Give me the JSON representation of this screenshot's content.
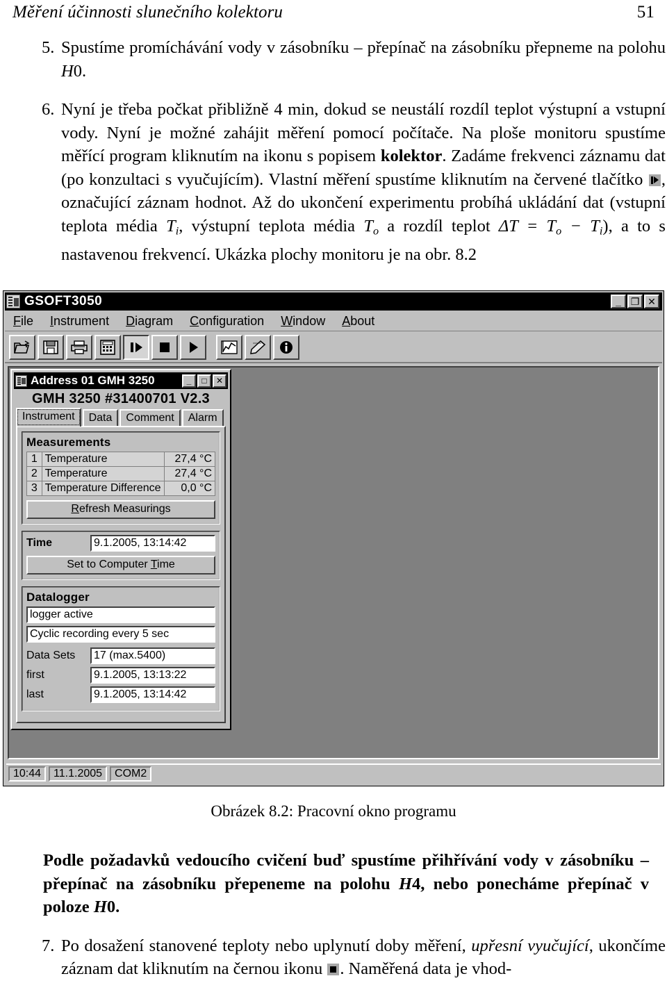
{
  "running_head": {
    "title": "Měření účinnosti slunečního kolektoru",
    "page_number": "51"
  },
  "items": [
    {
      "number": "5.",
      "text_parts": [
        "Spustíme promíchávání vody v zásobníku – přepínač na zásobníku přepneme na polohu ",
        "H",
        "0."
      ]
    },
    {
      "number": "6.",
      "lead": "Nyní je třeba počkat přibližně 4 min, dokud se neustálí rozdíl teplot výstupní a vstupní vody. Nyní je možné zahájit měření pomocí počítače. Na ploše monitoru spustíme měřící program kliknutím na ikonu s popisem ",
      "keyword": "kolektor",
      "mid": ". Zadáme frekvenci záznamu dat (po konzultaci s vyučujícím). Vlastní měření spustíme kliknutím na červené tlačítko ",
      "after_icon": ", označující záznam hodnot. Až do ukončení experimentu probíhá ukládání dat (vstupní teplota média ",
      "t_i": "T",
      "t_i_sub": "i",
      "mid2": ", výstupní teplota média ",
      "t_o": "T",
      "t_o_sub": "o",
      "mid3": " a rozdíl teplot ",
      "formula": "ΔT = T",
      "formula_sub1": "o",
      "formula_mid": " − T",
      "formula_sub2": "i",
      "tail": "), a to s nastavenou frekvencí. Ukázka plochy monitoru je na obr. 8.2"
    }
  ],
  "screenshot": {
    "window": {
      "title": "GSOFT3050",
      "icon": "device-icon",
      "controls": [
        {
          "name": "minimize-button",
          "glyph": "_"
        },
        {
          "name": "restore-button",
          "glyph": "❐"
        },
        {
          "name": "close-button",
          "glyph": "✕"
        }
      ]
    },
    "menubar": [
      {
        "mnemonic": "F",
        "rest": "ile"
      },
      {
        "mnemonic": "I",
        "rest": "nstrument"
      },
      {
        "mnemonic": "D",
        "rest": "iagram"
      },
      {
        "mnemonic": "C",
        "rest": "onfiguration"
      },
      {
        "mnemonic": "W",
        "rest": "indow"
      },
      {
        "mnemonic": "A",
        "rest": "bout"
      }
    ],
    "toolbar": [
      {
        "name": "open-file-icon",
        "pressed": false
      },
      {
        "name": "save-file-icon",
        "pressed": false
      },
      {
        "name": "print-icon",
        "pressed": false
      },
      {
        "name": "calculator-icon",
        "pressed": false
      },
      {
        "name": "record-start-icon",
        "pressed": true
      },
      {
        "name": "stop-icon",
        "pressed": false
      },
      {
        "name": "play-icon",
        "pressed": false
      },
      {
        "name": "chart-icon",
        "pressed": false
      },
      {
        "name": "edit-comment-icon",
        "pressed": false
      },
      {
        "name": "info-icon",
        "pressed": false
      }
    ],
    "child_window": {
      "title": "Address 01 GMH 3250",
      "controls": [
        {
          "name": "minimize-button",
          "glyph": "_"
        },
        {
          "name": "maximize-button",
          "glyph": "□"
        },
        {
          "name": "close-button",
          "glyph": "✕"
        }
      ],
      "device_line": "GMH 3250 #31400701 V2.3",
      "tabs": [
        {
          "label": "Instrument",
          "active": true
        },
        {
          "label": "Data",
          "active": false
        },
        {
          "label": "Comment",
          "active": false
        },
        {
          "label": "Alarm",
          "active": false
        }
      ],
      "measurements": {
        "title": "Measurements",
        "rows": [
          {
            "index": "1",
            "name": "Temperature",
            "value": "27,4 °C"
          },
          {
            "index": "2",
            "name": "Temperature",
            "value": "27,4 °C"
          },
          {
            "index": "3",
            "name": "Temperature Difference",
            "value": "0,0 °C"
          }
        ],
        "refresh_button": {
          "mnemonic": "R",
          "rest": "efresh Measurings"
        }
      },
      "time": {
        "label": "Time",
        "value": "9.1.2005, 13:14:42",
        "set_button_pre": "Set to Computer ",
        "set_button_mnemonic": "T",
        "set_button_post": "ime"
      },
      "datalogger": {
        "title": "Datalogger",
        "status": "logger active",
        "mode": "Cyclic recording every 5 sec",
        "rows": [
          {
            "label": "Data Sets",
            "value": "17 (max.5400)"
          },
          {
            "label": "first",
            "value": "9.1.2005, 13:13:22"
          },
          {
            "label": "last",
            "value": "9.1.2005, 13:14:42"
          }
        ]
      }
    },
    "statusbar": [
      {
        "name": "status-time",
        "text": "10:44"
      },
      {
        "name": "status-date",
        "text": "11.1.2005"
      },
      {
        "name": "status-port",
        "text": "COM2"
      }
    ]
  },
  "caption": "Obrázek 8.2: Pracovní okno programu",
  "after_figure": {
    "bold_lead": "Podle požadavků vedoucího cvičení buď spustíme přihřívání vody v zásobníku – přepínač na zásobníku přepeneme na polohu ",
    "bold_h4": "H",
    "bold_h4_num": "4",
    "bold_mid": ", nebo ponecháme přepínač v poloze ",
    "bold_h0": "H",
    "bold_h0_num": "0",
    "bold_end": ".",
    "item7_number": "7.",
    "item7_lead": "Po dosažení stanovené teploty nebo uplynutí doby měření, ",
    "item7_italic": "upřesní vyučující",
    "item7_mid": ", ukončíme záznam dat kliknutím na černou ikonu ",
    "item7_tail": ". Naměřená data je vhod-"
  },
  "colors": {
    "window_face": "#c0c0c0",
    "titlebar": "#000000",
    "mdi_background": "#808080",
    "field_background": "#ffffff"
  }
}
